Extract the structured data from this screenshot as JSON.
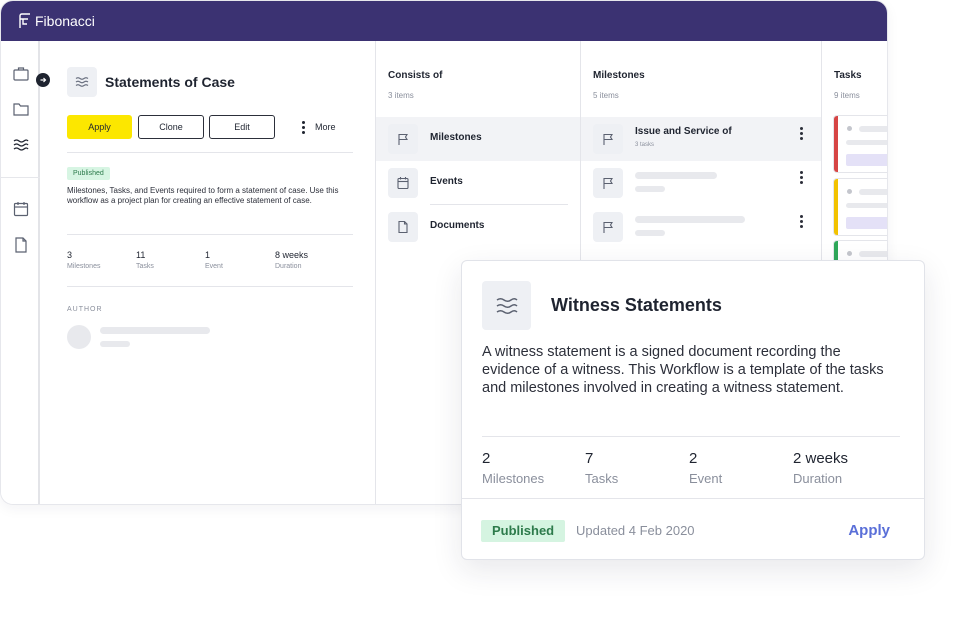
{
  "app": {
    "brand": "Fibonacci"
  },
  "detail": {
    "title": "Statements of Case",
    "buttons": {
      "apply": "Apply",
      "clone": "Clone",
      "edit": "Edit",
      "more": "More"
    },
    "status": "Published",
    "description": "Milestones, Tasks, and Events required to form a statement of case. Use this workflow as a project plan for creating an effective statement of case.",
    "stats": [
      {
        "value": "3",
        "label": "Milestones"
      },
      {
        "value": "11",
        "label": "Tasks"
      },
      {
        "value": "1",
        "label": "Event"
      },
      {
        "value": "8 weeks",
        "label": "Duration"
      }
    ],
    "author_heading": "AUTHOR"
  },
  "consists_of": {
    "heading": "Consists of",
    "count": "3 items",
    "items": [
      {
        "label": "Milestones",
        "icon": "flag-icon",
        "selected": true
      },
      {
        "label": "Events",
        "icon": "calendar-icon"
      },
      {
        "label": "Documents",
        "icon": "document-icon"
      }
    ]
  },
  "milestones": {
    "heading": "Milestones",
    "count": "5 items",
    "items": [
      {
        "title": "Issue and Service of",
        "sub": "3 tasks",
        "icon": "flag-icon",
        "selected": true
      }
    ]
  },
  "tasks": {
    "heading": "Tasks",
    "count": "9 items",
    "colors": [
      "#d64545",
      "#f2c200",
      "#2fa85a"
    ]
  },
  "card": {
    "title": "Witness Statements",
    "icon": "waves-icon",
    "description": "A witness statement is a signed document recording the evidence of a witness. This Workflow is a template of the tasks and milestones involved in creating a witness statement.",
    "stats": [
      {
        "value": "2",
        "label": "Milestones"
      },
      {
        "value": "7",
        "label": "Tasks"
      },
      {
        "value": "2",
        "label": "Event"
      },
      {
        "value": "2 weeks",
        "label": "Duration"
      }
    ],
    "status": "Published",
    "updated": "Updated 4 Feb 2020",
    "apply": "Apply"
  },
  "colors": {
    "topbar": "#3b3272",
    "apply_button": "#fce700",
    "link": "#5a6fd8",
    "badge_bg": "#d5f4e1"
  }
}
